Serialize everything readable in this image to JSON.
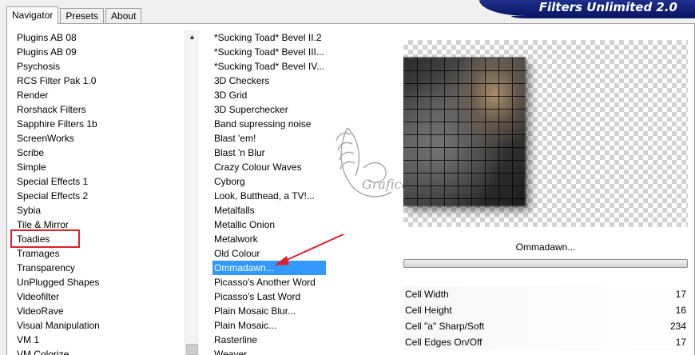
{
  "tabs": [
    "Navigator",
    "Presets",
    "About"
  ],
  "banner_title": "Filters Unlimited 2.0",
  "categories": [
    "Plugins AB 08",
    "Plugins AB 09",
    "Psychosis",
    "RCS Filter Pak 1.0",
    "Render",
    "Rorshack Filters",
    "Sapphire Filters 1b",
    "ScreenWorks",
    "Scribe",
    "Simple",
    "Special Effects 1",
    "Special Effects 2",
    "Sybia",
    "Tile & Mirror",
    "Toadies",
    "Tramages",
    "Transparency",
    "UnPlugged Shapes",
    "Videofilter",
    "VideoRave",
    "Visual Manipulation",
    "VM 1",
    "VM Colorize"
  ],
  "selected_category": "Toadies",
  "filters": [
    "*Sucking Toad*  Bevel II.2",
    "*Sucking Toad*  Bevel III...",
    "*Sucking Toad*  Bevel IV...",
    "3D Checkers",
    "3D Grid",
    "3D Superchecker",
    "Band supressing noise",
    "Blast 'em!",
    "Blast 'n Blur",
    "Crazy Colour Waves",
    "Cyborg",
    "Look, Butthead, a TV!...",
    "Metalfalls",
    "Metallic Onion",
    "Metalwork",
    "Old Colour",
    "Ommadawn...",
    "Picasso's Another Word",
    "Picasso's Last Word",
    "Plain Mosaic Blur...",
    "Plain Mosaic...",
    "Rasterline",
    "Weaver"
  ],
  "selected_filter": "Ommadawn...",
  "effect_name": "Ommadawn...",
  "params": [
    {
      "label": "Cell Width",
      "value": "17"
    },
    {
      "label": "Cell Height",
      "value": "16"
    },
    {
      "label": "Cell \"a\" Sharp/Soft",
      "value": "234"
    },
    {
      "label": "Cell Edges On/Off",
      "value": "17"
    }
  ],
  "watermark_text": "Grafica Mia",
  "colors": {
    "selection": "#3399ff",
    "annotation_red": "#e0202a",
    "banner_blue": "#0b1766"
  }
}
